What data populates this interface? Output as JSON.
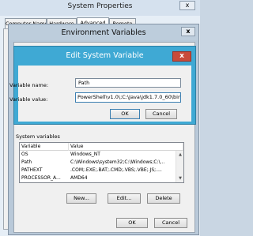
{
  "system_properties": {
    "title": "System Properties",
    "close_glyph": "x",
    "tabs": [
      {
        "label": "Computer Name"
      },
      {
        "label": "Hardware"
      },
      {
        "label": "Advanced"
      },
      {
        "label": "Remote"
      }
    ],
    "active_tab": "Advanced"
  },
  "environment_variables": {
    "title": "Environment Variables",
    "close_glyph": "x",
    "system_variables": {
      "label": "System variables",
      "columns": [
        "Variable",
        "Value"
      ],
      "rows": [
        {
          "name": "OS",
          "value": "Windows_NT"
        },
        {
          "name": "Path",
          "value": "C:\\Windows\\system32;C:\\Windows;C:\\..."
        },
        {
          "name": "PATHEXT",
          "value": ".COM;.EXE;.BAT;.CMD;.VBS;.VBE;.JS;...."
        },
        {
          "name": "PROCESSOR_A...",
          "value": "AMD64"
        }
      ]
    },
    "buttons": {
      "new": "New...",
      "edit": "Edit...",
      "delete": "Delete",
      "ok": "OK",
      "cancel": "Cancel"
    }
  },
  "edit_system_variable": {
    "title": "Edit System Variable",
    "close_glyph": "x",
    "variable_name_label": "Variable name:",
    "variable_name_value": "Path",
    "variable_value_label": "Variable value:",
    "variable_value_value": "PowerShell\\v1.0\\;C:\\Java\\jdk1.7.0_60\\bin",
    "ok": "OK",
    "cancel": "Cancel"
  },
  "colors": {
    "edit_title_bar": "#3fa9d4",
    "close_button_red": "#c94b3b"
  }
}
